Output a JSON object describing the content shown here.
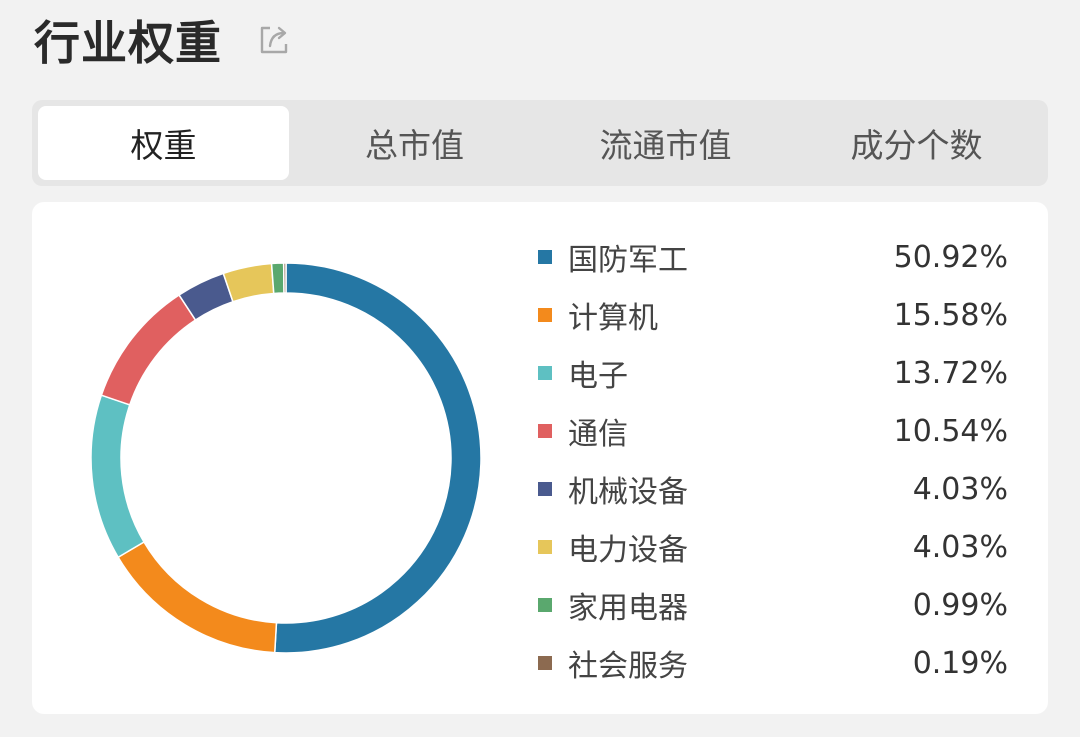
{
  "page": {
    "title": "行业权重"
  },
  "icons": {
    "share": "share-icon"
  },
  "tabs": [
    {
      "label": "权重",
      "active": true
    },
    {
      "label": "总市值",
      "active": false
    },
    {
      "label": "流通市值",
      "active": false
    },
    {
      "label": "成分个数",
      "active": false
    }
  ],
  "chart_data": {
    "type": "pie",
    "categories": [
      "国防军工",
      "计算机",
      "电子",
      "通信",
      "机械设备",
      "电力设备",
      "家用电器",
      "社会服务"
    ],
    "values": [
      50.92,
      15.58,
      13.72,
      10.54,
      4.03,
      4.03,
      0.99,
      0.19
    ],
    "value_labels": [
      "50.92%",
      "15.58%",
      "13.72%",
      "10.54%",
      "4.03%",
      "4.03%",
      "0.99%",
      "0.19%"
    ],
    "colors": [
      "#2577a4",
      "#f38a1c",
      "#5ec0c2",
      "#e06060",
      "#4a5a8e",
      "#e6c65a",
      "#5aa86e",
      "#8c6a50"
    ],
    "donut": true,
    "legend": "right"
  }
}
